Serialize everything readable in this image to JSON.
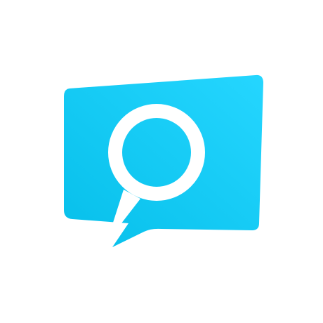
{
  "logo": {
    "icon": "chat-bubble-search-icon",
    "colors": {
      "background": "#ffffff",
      "bubble_start": "#06BFEA",
      "bubble_end": "#25D6FF",
      "magnifier": "#ffffff"
    }
  }
}
